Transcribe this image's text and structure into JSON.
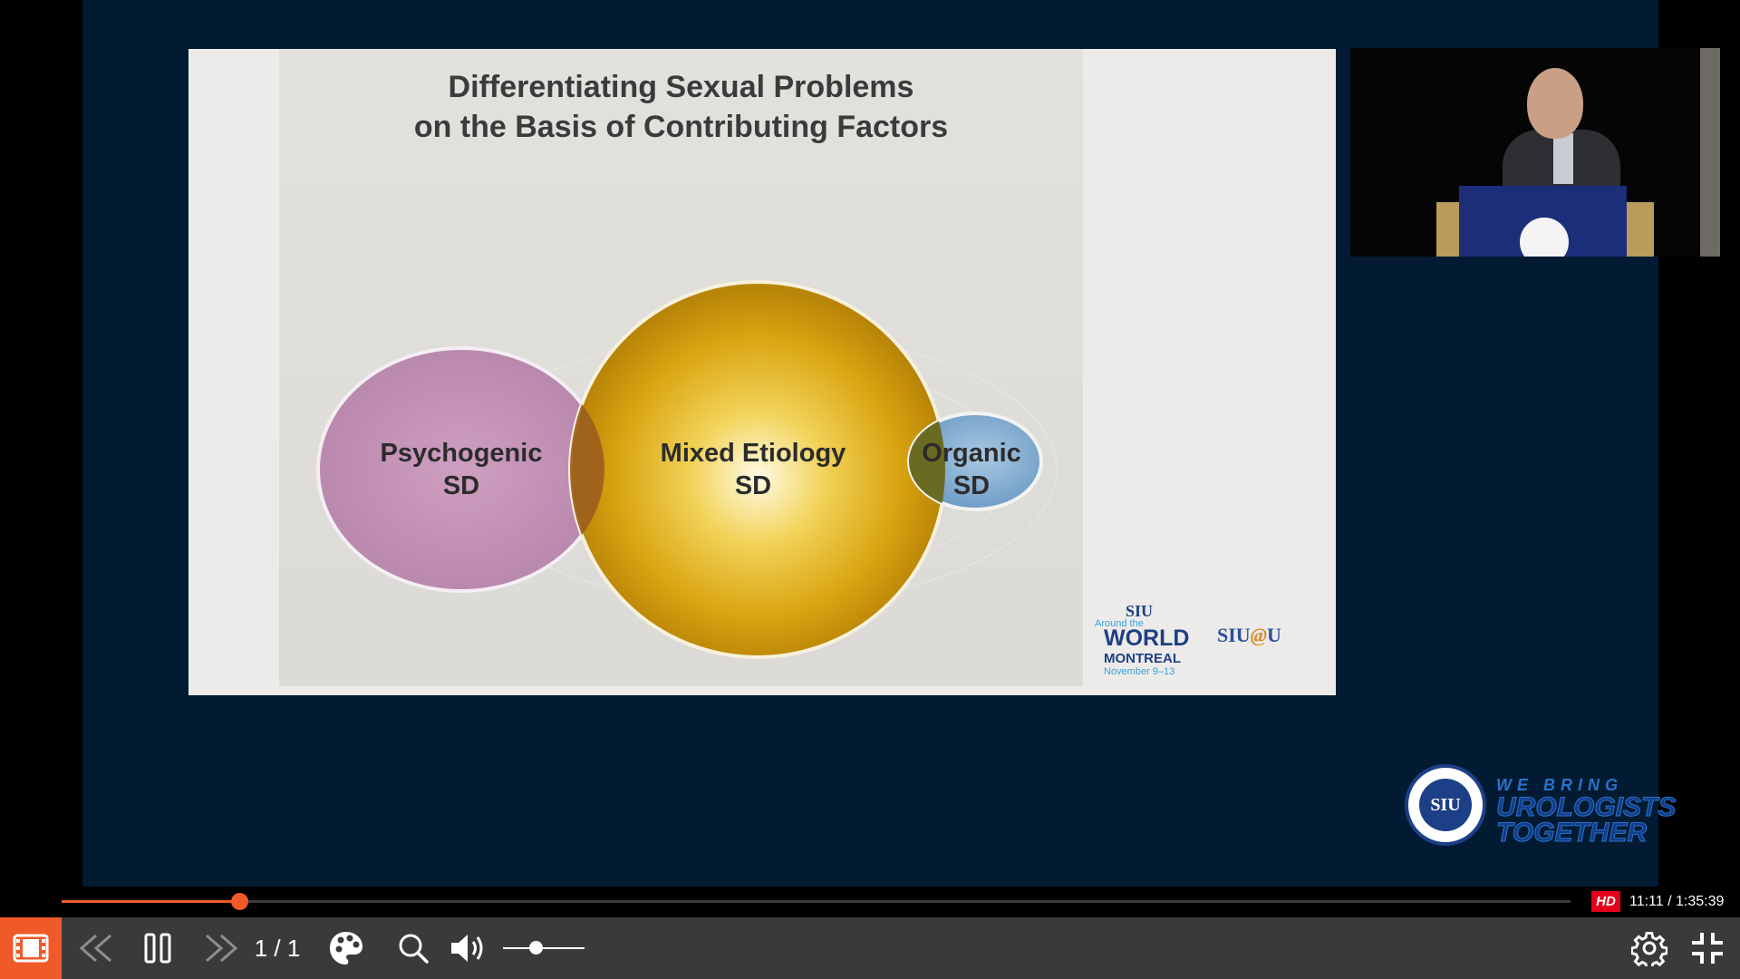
{
  "slide": {
    "title_line1": "Differentiating Sexual Problems",
    "title_line2": "on the Basis of Contributing Factors",
    "circles": [
      {
        "label_line1": "Psychogenic",
        "label_line2": "SD",
        "color": "#c08fb3"
      },
      {
        "label_line1": "Mixed Etiology",
        "label_line2": "SD",
        "color": "#d6a20d"
      },
      {
        "label_line1": "Organic",
        "label_line2": "SD",
        "color": "#7ea9cf"
      }
    ],
    "logo_world": {
      "line1": "SIU",
      "line2": "Around the",
      "line3": "WORLD",
      "line4": "MONTREAL",
      "line5": "November 9–13"
    },
    "logo_siuu": {
      "prefix": "SIU",
      "at": "@",
      "suffix": "U"
    }
  },
  "brand": {
    "seal_text": "SIU",
    "line1": "WE BRING",
    "line2": "UROLOGISTS",
    "line3": "TOGETHER"
  },
  "player": {
    "progress_fraction": 0.118,
    "hd_label": "HD",
    "time": "11:11 / 1:35:39",
    "page_counter": "1 / 1",
    "volume_fraction": 0.4,
    "accent_color": "#ef5a28",
    "icons": [
      "filmstrip-icon",
      "skip-back-icon",
      "pause-icon",
      "skip-forward-icon",
      "palette-icon",
      "search-icon",
      "volume-icon",
      "gear-icon",
      "exit-fullscreen-icon"
    ]
  }
}
